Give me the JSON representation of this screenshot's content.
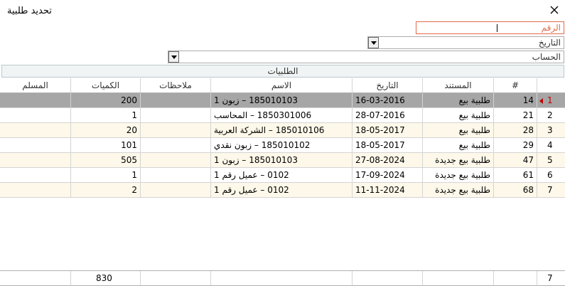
{
  "window": {
    "title": "تحديد طلبية"
  },
  "filters": {
    "number_label": "الرقم",
    "date_label": "التاريخ",
    "account_label": "الحساب"
  },
  "group": {
    "title": "الطلبيات"
  },
  "table": {
    "headers": {
      "muslim": "المسلم",
      "qty": "الكميات",
      "notes": "ملاحظات",
      "name": "الاسم",
      "date": "التاريخ",
      "doc": "المستند",
      "no": "#"
    },
    "rows": [
      {
        "index": "1",
        "no": "14",
        "doc": "طلبية بيع",
        "date": "16-03-2016",
        "name": "185010103 – زبون 1",
        "notes": "",
        "qty": "200",
        "muslim": ""
      },
      {
        "index": "2",
        "no": "21",
        "doc": "طلبية بيع",
        "date": "28-07-2016",
        "name": "1850301006 – المحاسب",
        "notes": "",
        "qty": "1",
        "muslim": ""
      },
      {
        "index": "3",
        "no": "28",
        "doc": "طلبية بيع",
        "date": "18-05-2017",
        "name": "185010106 – الشركة العربية",
        "notes": "",
        "qty": "20",
        "muslim": ""
      },
      {
        "index": "4",
        "no": "29",
        "doc": "طلبية بيع",
        "date": "18-05-2017",
        "name": "185010102 – زبون نقدي",
        "notes": "",
        "qty": "101",
        "muslim": ""
      },
      {
        "index": "5",
        "no": "47",
        "doc": "طلبية بيع جديدة",
        "date": "27-08-2024",
        "name": "185010103 – زبون 1",
        "notes": "",
        "qty": "505",
        "muslim": ""
      },
      {
        "index": "6",
        "no": "61",
        "doc": "طلبية بيع جديدة",
        "date": "17-09-2024",
        "name": "0102 – عميل رقم 1",
        "notes": "",
        "qty": "1",
        "muslim": ""
      },
      {
        "index": "7",
        "no": "68",
        "doc": "طلبية بيع جديدة",
        "date": "11-11-2024",
        "name": "0102 – عميل رقم 1",
        "notes": "",
        "qty": "2",
        "muslim": ""
      }
    ],
    "footer": {
      "count": "7",
      "qty_total": "830"
    }
  }
}
